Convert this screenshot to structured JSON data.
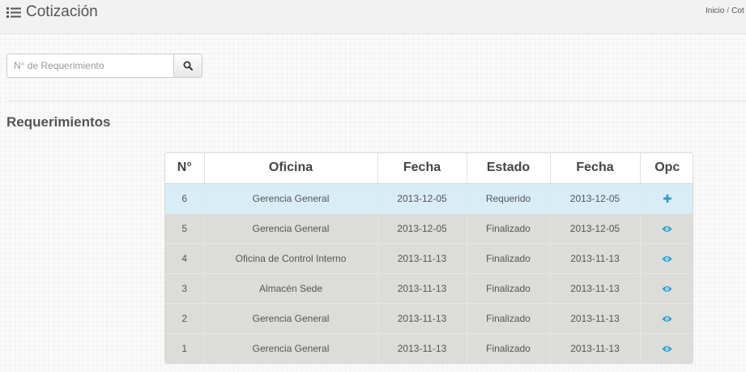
{
  "header": {
    "title": "Cotización",
    "breadcrumb": [
      "Inicio",
      "Cot"
    ]
  },
  "search": {
    "placeholder": "N° de Requerimiento",
    "value": ""
  },
  "section": {
    "title": "Requerimientos"
  },
  "table": {
    "columns": [
      "N°",
      "Oficina",
      "Fecha",
      "Estado",
      "Fecha",
      "Opc"
    ],
    "rows": [
      {
        "num": "6",
        "oficina": "Gerencia General",
        "fecha1": "2013-12-05",
        "estado": "Requerido",
        "fecha2": "2013-12-05",
        "action": "plus-icon"
      },
      {
        "num": "5",
        "oficina": "Gerencia General",
        "fecha1": "2013-12-05",
        "estado": "Finalizado",
        "fecha2": "2013-12-05",
        "action": "eye-icon"
      },
      {
        "num": "4",
        "oficina": "Oficina de Control Interno",
        "fecha1": "2013-11-13",
        "estado": "Finalizado",
        "fecha2": "2013-11-13",
        "action": "eye-icon"
      },
      {
        "num": "3",
        "oficina": "Almacén Sede",
        "fecha1": "2013-11-13",
        "estado": "Finalizado",
        "fecha2": "2013-11-13",
        "action": "eye-icon"
      },
      {
        "num": "2",
        "oficina": "Gerencia General",
        "fecha1": "2013-11-13",
        "estado": "Finalizado",
        "fecha2": "2013-11-13",
        "action": "eye-icon"
      },
      {
        "num": "1",
        "oficina": "Gerencia General",
        "fecha1": "2013-11-13",
        "estado": "Finalizado",
        "fecha2": "2013-11-13",
        "action": "eye-icon"
      }
    ]
  },
  "colors": {
    "accent": "#2a9fd6",
    "active_row": "#d9edf7",
    "row": "#dcdcd8"
  }
}
